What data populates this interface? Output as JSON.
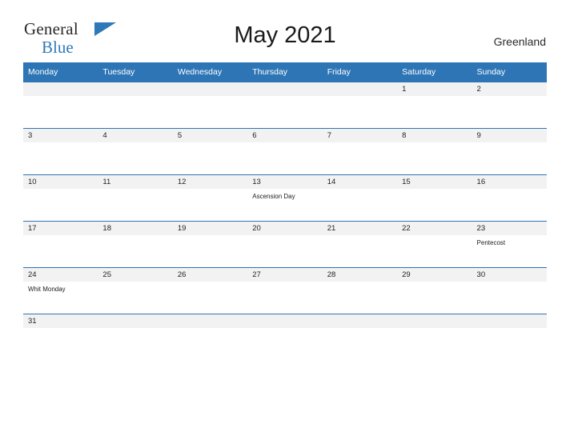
{
  "brand": {
    "name_part1": "General",
    "name_part2": "Blue",
    "flag_icon": "flag-triangle-icon"
  },
  "header": {
    "title": "May 2021",
    "country": "Greenland"
  },
  "calendar": {
    "weekday_headers": [
      "Monday",
      "Tuesday",
      "Wednesday",
      "Thursday",
      "Friday",
      "Saturday",
      "Sunday"
    ],
    "accent_color": "#2e75b6",
    "cell_bg": "#f2f2f2",
    "weeks": [
      [
        {
          "day": "",
          "event": ""
        },
        {
          "day": "",
          "event": ""
        },
        {
          "day": "",
          "event": ""
        },
        {
          "day": "",
          "event": ""
        },
        {
          "day": "",
          "event": ""
        },
        {
          "day": "1",
          "event": ""
        },
        {
          "day": "2",
          "event": ""
        }
      ],
      [
        {
          "day": "3",
          "event": ""
        },
        {
          "day": "4",
          "event": ""
        },
        {
          "day": "5",
          "event": ""
        },
        {
          "day": "6",
          "event": ""
        },
        {
          "day": "7",
          "event": ""
        },
        {
          "day": "8",
          "event": ""
        },
        {
          "day": "9",
          "event": ""
        }
      ],
      [
        {
          "day": "10",
          "event": ""
        },
        {
          "day": "11",
          "event": ""
        },
        {
          "day": "12",
          "event": ""
        },
        {
          "day": "13",
          "event": "Ascension Day"
        },
        {
          "day": "14",
          "event": ""
        },
        {
          "day": "15",
          "event": ""
        },
        {
          "day": "16",
          "event": ""
        }
      ],
      [
        {
          "day": "17",
          "event": ""
        },
        {
          "day": "18",
          "event": ""
        },
        {
          "day": "19",
          "event": ""
        },
        {
          "day": "20",
          "event": ""
        },
        {
          "day": "21",
          "event": ""
        },
        {
          "day": "22",
          "event": ""
        },
        {
          "day": "23",
          "event": "Pentecost"
        }
      ],
      [
        {
          "day": "24",
          "event": "Whit Monday"
        },
        {
          "day": "25",
          "event": ""
        },
        {
          "day": "26",
          "event": ""
        },
        {
          "day": "27",
          "event": ""
        },
        {
          "day": "28",
          "event": ""
        },
        {
          "day": "29",
          "event": ""
        },
        {
          "day": "30",
          "event": ""
        }
      ],
      [
        {
          "day": "31",
          "event": ""
        },
        {
          "day": "",
          "event": ""
        },
        {
          "day": "",
          "event": ""
        },
        {
          "day": "",
          "event": ""
        },
        {
          "day": "",
          "event": ""
        },
        {
          "day": "",
          "event": ""
        },
        {
          "day": "",
          "event": ""
        }
      ]
    ]
  }
}
